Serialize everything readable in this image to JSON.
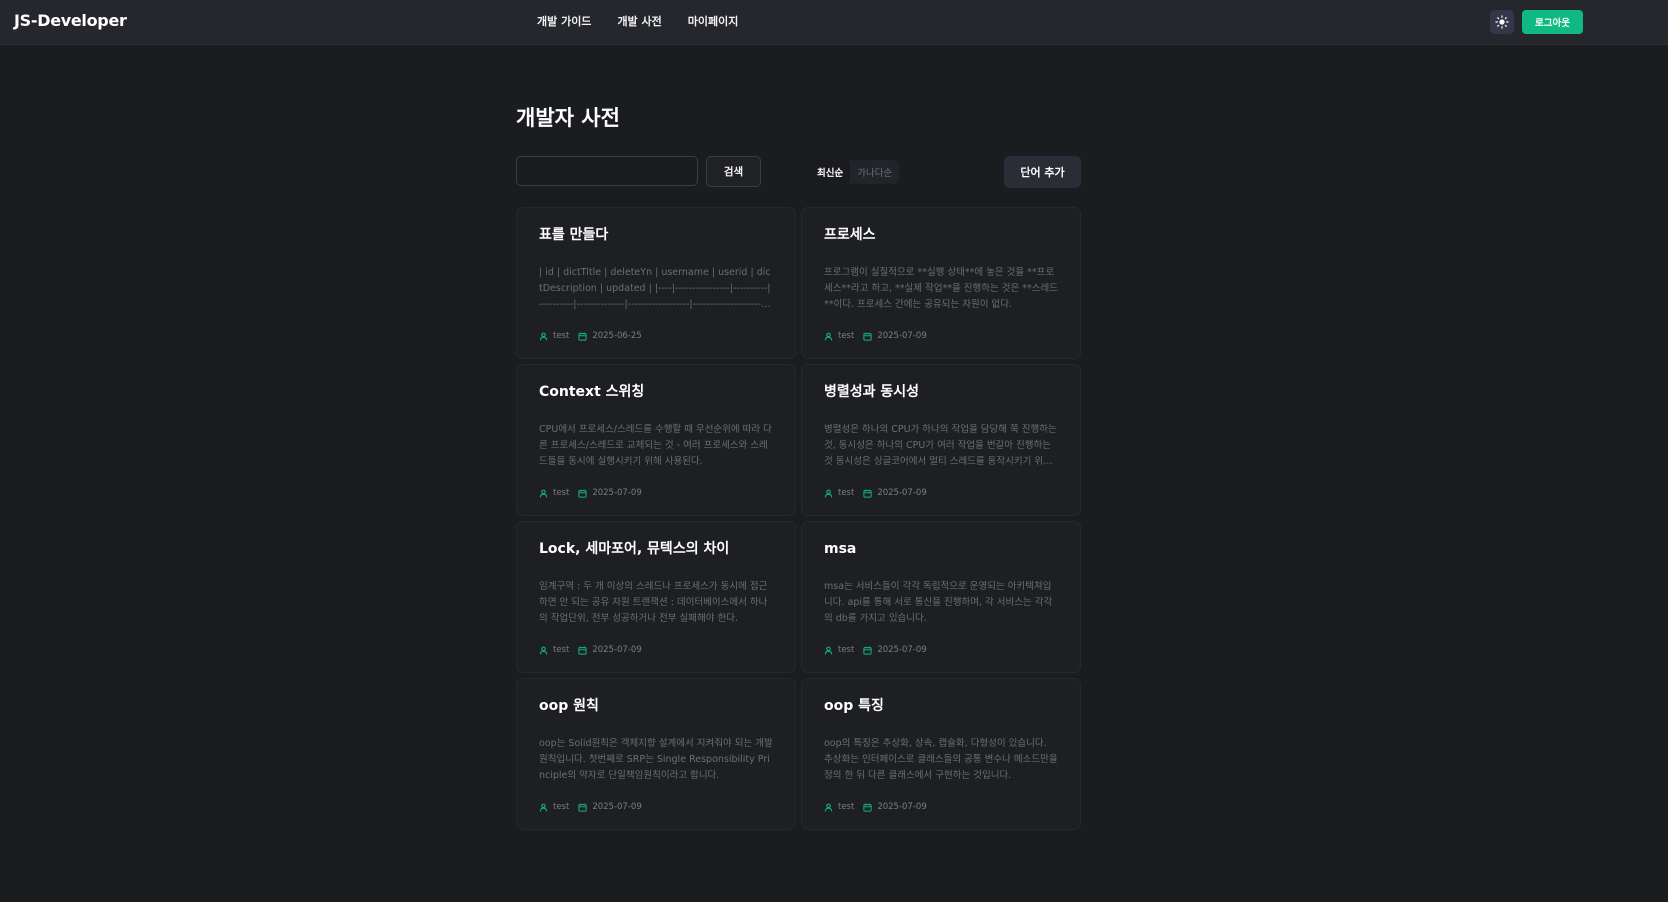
{
  "header": {
    "brand": "JS-Developer",
    "nav": [
      "개발 가이드",
      "개발 사전",
      "마이페이지"
    ],
    "theme_toggle_icon": "sun-icon",
    "logout_label": "로그아웃",
    "accent_color": "#10b981"
  },
  "main": {
    "title": "개발자 사전",
    "search": {
      "value": "",
      "button_label": "검색"
    },
    "sort": {
      "options": [
        "최신순",
        "가나다순"
      ],
      "selected": "최신순"
    },
    "add_button_label": "단어 추가",
    "cards": [
      {
        "title": "표를 만들다",
        "description": "| id | dictTitle | deleteYn | username | userid | dictDescription | updated | |----|----------------|----------|----------|--------------|------------------|----------------------------------|",
        "author": "test",
        "date": "2025-06-25"
      },
      {
        "title": "프로세스",
        "description": "프로그램이 실질적으로 **실행 상태**에 놓은 것을 **프로세스**라고 하고, **실제 작업**을 진행하는 것은 **스레드**이다. 프로세스 간에는 공유되는 자원이 없다.",
        "author": "test",
        "date": "2025-07-09"
      },
      {
        "title": "Context 스위칭",
        "description": "CPU에서 프로세스/스레드를 수행할 때 우선순위에 따라 다른 프로세스/스레드로 교체되는 것 - 여러 프로세스와 스레드들을 동시에 실행시키기 위해 사용된다.",
        "author": "test",
        "date": "2025-07-09"
      },
      {
        "title": "병렬성과 동시성",
        "description": "병렬성은 하나의 CPU가 하나의 작업을 담당해 쭉 진행하는 것, 동시성은 하나의 CPU가 여러 작업을 번갈아 진행하는 것 동시성은 싱글코어에서 멀티 스레드를 동작시키기 위한 방식",
        "author": "test",
        "date": "2025-07-09"
      },
      {
        "title": "Lock, 세마포어, 뮤텍스의 차이",
        "description": "임계구역 : 두 개 이상의 스레드나 프로세스가 동시에 접근하면 안 되는 공유 자원 트랜잭션 : 데이터베이스에서 하나의 작업단위, 전부 성공하거나 전부 실패해야 한다.",
        "author": "test",
        "date": "2025-07-09"
      },
      {
        "title": "msa",
        "description": "msa는 서비스들이 각각 독립적으로 운영되는 아키텍쳐입니다. api를 통해 서로 통신을 진행하며, 각 서비스는 각각의 db를 가지고 있습니다.",
        "author": "test",
        "date": "2025-07-09"
      },
      {
        "title": "oop 원칙",
        "description": "oop는 Solid원칙은 객체지향 설계에서 지켜줘야 되는 개발원칙입니다. 첫번째로 SRP는 Single Responsibility Principle의 약자로 단일책임원칙이라고 합니다.",
        "author": "test",
        "date": "2025-07-09"
      },
      {
        "title": "oop 특징",
        "description": "oop의 특징은 추상화, 상속, 캡슐화, 다형성이 있습니다. 추상화는 인터페이스로 클래스들의 공통 변수나 메소드만을 정의 한 뒤 다른 클래스에서 구현하는 것입니다.",
        "author": "test",
        "date": "2025-07-09"
      }
    ],
    "meta_icons": {
      "author": "user-icon",
      "date": "calendar-icon"
    }
  }
}
